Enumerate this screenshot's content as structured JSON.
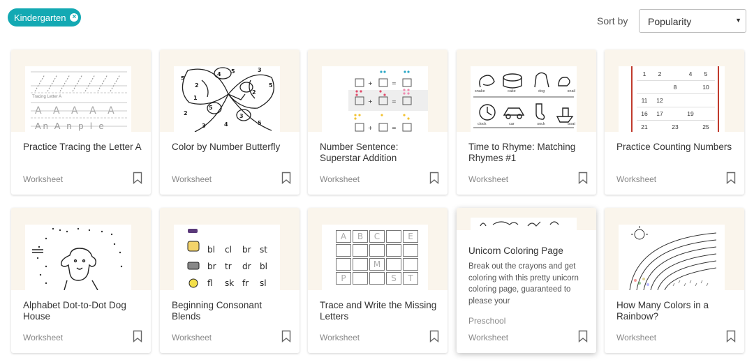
{
  "filters": {
    "chip_label": "Kindergarten",
    "chip_close": "×"
  },
  "sort": {
    "label": "Sort by",
    "selected": "Popularity",
    "caret": "▼"
  },
  "cards": [
    {
      "title": "Practice Tracing the Letter A",
      "type": "Worksheet"
    },
    {
      "title": "Color by Number Butterfly",
      "type": "Worksheet"
    },
    {
      "title": "Number Sentence: Superstar Addition",
      "type": "Worksheet"
    },
    {
      "title": "Time to Rhyme: Matching Rhymes #1",
      "type": "Worksheet"
    },
    {
      "title": "Practice Counting Numbers",
      "type": "Worksheet"
    },
    {
      "title": "Alphabet Dot-to-Dot Dog House",
      "type": "Worksheet"
    },
    {
      "title": "Beginning Consonant Blends",
      "type": "Worksheet"
    },
    {
      "title": "Trace and Write the Missing Letters",
      "type": "Worksheet"
    },
    {
      "title": "Unicorn Coloring Page",
      "type": "Worksheet",
      "description": "Break out the crayons and get coloring with this pretty unicorn coloring page, guaranteed to please your",
      "grade": "Preschool"
    },
    {
      "title": "How Many Colors in a Rainbow?",
      "type": "Worksheet"
    }
  ],
  "thumbs": {
    "tracing": {
      "caption": "Tracing Letter A",
      "letters": "A A A A A",
      "bottom": "An  A n p l e"
    },
    "counting": {
      "rows": [
        [
          "1",
          "2",
          "",
          "4",
          "5"
        ],
        [
          "",
          "",
          "8",
          "",
          "10"
        ],
        [
          "11",
          "12",
          "",
          "",
          ""
        ],
        [
          "16",
          "17",
          "",
          "19",
          ""
        ],
        [
          "21",
          "",
          "23",
          "",
          "25"
        ]
      ]
    },
    "rhyme": {
      "words1": [
        "snake",
        "cake",
        "dog",
        "snail"
      ],
      "words2": [
        "clock",
        "car",
        "sock",
        "boat"
      ]
    },
    "blends": {
      "rows": [
        [
          "bl",
          "cl",
          "br",
          "st"
        ],
        [
          "br",
          "tr",
          "dr",
          "bl"
        ],
        [
          "fl",
          "sk",
          "fr",
          "sl"
        ]
      ]
    },
    "trace": {
      "letters": [
        "A",
        "B",
        "C",
        "",
        "E",
        "",
        "",
        "",
        "",
        "",
        "",
        "",
        "M",
        "",
        "",
        "P",
        "",
        "",
        "S",
        "T"
      ]
    }
  }
}
